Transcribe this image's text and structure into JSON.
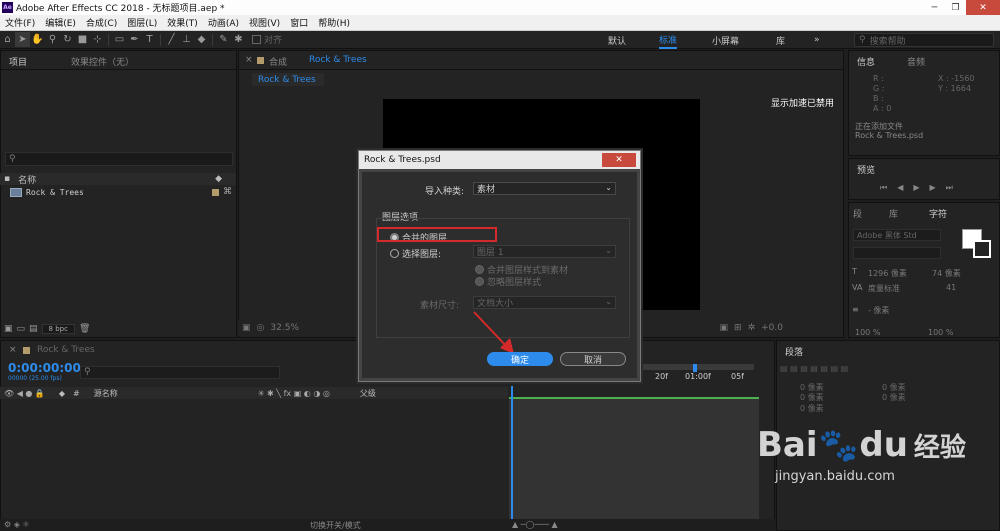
{
  "window": {
    "logo": "Ae",
    "title": "Adobe After Effects CC 2018 - 无标题项目.aep *",
    "minimize": "─",
    "restore": "❐",
    "close": "✕"
  },
  "menu": [
    "文件(F)",
    "编辑(E)",
    "合成(C)",
    "图层(L)",
    "效果(T)",
    "动画(A)",
    "视图(V)",
    "窗口",
    "帮助(H)"
  ],
  "toolbar": {
    "snap_label": "对齐",
    "workspaces": [
      "默认",
      "标准",
      "小屏幕",
      "库"
    ],
    "active_workspace": "标准",
    "overflow": "»",
    "search_placeholder": "搜索帮助"
  },
  "project_panel": {
    "tab_project": "项目",
    "tab_effects": "效果控件（无）",
    "search_icon": "⚲",
    "column_name": "名称",
    "item_name": "Rock & Trees",
    "bpc": "8 bpc"
  },
  "comp_panel": {
    "tab_label": "合成",
    "tab_comp": "Rock & Trees",
    "subtab": "Rock & Trees",
    "gpu_message": "显示加速已禁用",
    "zoom": "32.5%",
    "exposure": "+0.0"
  },
  "info_panel": {
    "tab_info": "信息",
    "tab_audio": "音频",
    "rgba_labels": [
      "R :",
      "G :",
      "B :",
      "A : 0"
    ],
    "x": "X : -1560",
    "y": "Y : 1664",
    "status_line1": "正在添加文件",
    "status_line2": "Rock & Trees.psd"
  },
  "preview_panel": {
    "tab": "预览"
  },
  "char_panel": {
    "tab_paragraph_left": "段",
    "tab_library": "库",
    "tab_character": "字符",
    "font": "Adobe 黑体 Std",
    "size": "1296 像素",
    "leading": "74 像素",
    "kerning": "度量标准",
    "tracking": "41",
    "stroke": "- 像素",
    "scale_v": "100 %",
    "scale_h": "100 %"
  },
  "align_panel": {
    "tab": "段落",
    "rows": [
      "0 像素",
      "0 像素",
      "0 像素",
      "0 像素",
      "0 像素"
    ]
  },
  "timeline": {
    "tab": "Rock & Trees",
    "timecode": "0:00:00:00",
    "timecode_sub": "00000 (25.00 fps)",
    "col_source": "源名称",
    "col_parent": "父级",
    "ruler_ticks": [
      "20f",
      "01:00f",
      "05f"
    ],
    "footer_toggle": "切换开关/模式"
  },
  "dialog": {
    "title": "Rock & Trees.psd",
    "close": "✕",
    "import_kind_label": "导入种类:",
    "import_kind_value": "素材",
    "layer_options": "图层选项",
    "opt_merged": "合并的图层",
    "opt_choose": "选择图层:",
    "layer_select": "图层 1",
    "sub_merge_styles": "合并图层样式到素材",
    "sub_ignore_styles": "忽略图层样式",
    "footage_size_label": "素材尺寸:",
    "footage_size_value": "文档大小",
    "ok": "确定",
    "cancel": "取消"
  },
  "watermark": {
    "text_a": "Bai",
    "text_b": "du",
    "cn": "经验",
    "url": "jingyan.baidu.com"
  },
  "colors": {
    "accent": "#2d8ceb",
    "highlight_red": "#d62a2a",
    "close_red": "#c74a3d"
  }
}
